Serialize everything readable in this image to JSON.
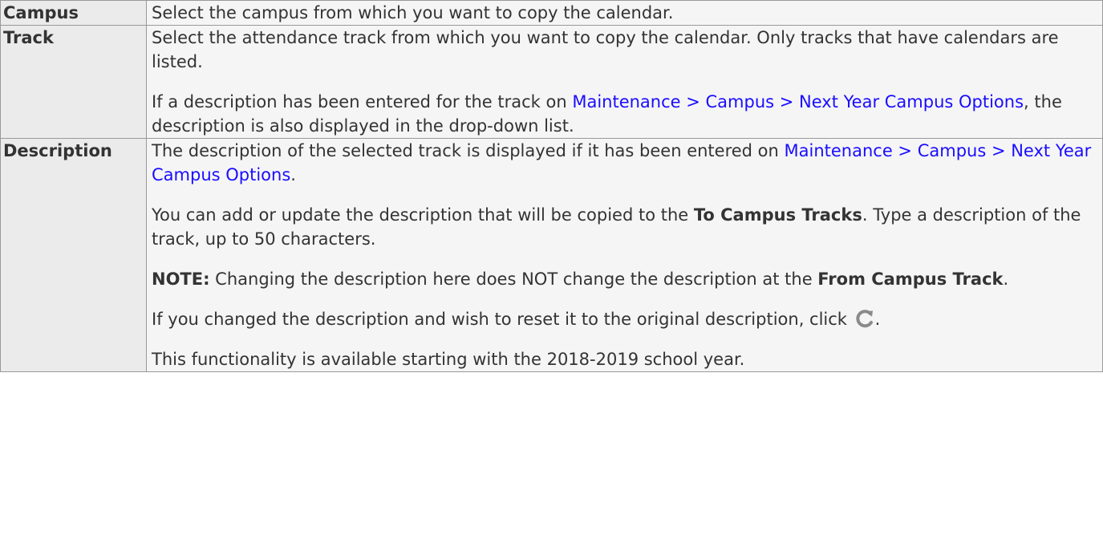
{
  "rows": [
    {
      "label": "Campus",
      "text": "Select the campus from which you want to copy the calendar."
    },
    {
      "label": "Track",
      "p1": "Select the attendance track from which you want to copy the calendar. Only tracks that have calendars are listed.",
      "p2_before": "If a description has been entered for the track on ",
      "p2_link": "Maintenance > Campus > Next Year Campus Options",
      "p2_after": ", the description is also displayed in the drop-down list."
    },
    {
      "label": "Description",
      "p1_before": "The description of the selected track is displayed if it has been entered on ",
      "p1_link": "Maintenance > Campus > Next Year Campus Options",
      "p1_after": ".",
      "p2_before": "You can add or update the description that will be copied to the ",
      "p2_bold": "To Campus Tracks",
      "p2_after": ". Type a description of the track, up to 50 characters.",
      "p3_note": "NOTE:",
      "p3_mid": " Changing the description here does NOT change the description at the ",
      "p3_bold": "From Campus Track",
      "p3_after": ".",
      "p4_before": "If you changed the description and wish to reset it to the original description, click ",
      "p4_after": ".",
      "p5": "This functionality is available starting with the 2018-2019 school year."
    }
  ],
  "icons": {
    "reset": "refresh-icon",
    "reset_color": "#8a8a8a"
  }
}
